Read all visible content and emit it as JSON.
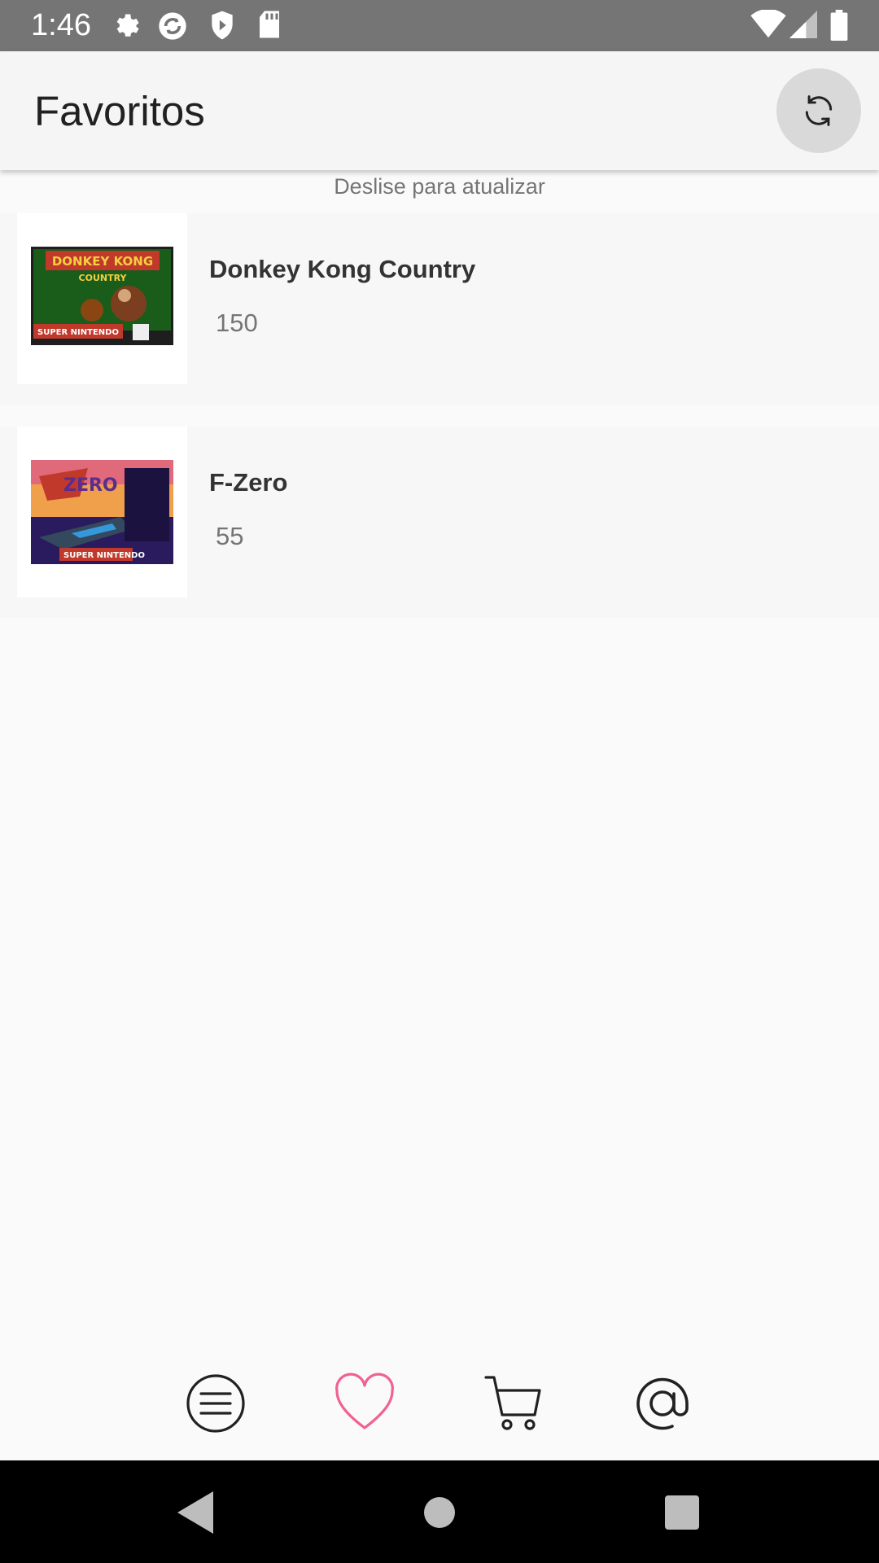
{
  "status_bar": {
    "time": "1:46",
    "icons_left": [
      "gear-icon",
      "sync-icon",
      "shield-icon",
      "sd-card-icon"
    ],
    "icons_right": [
      "wifi-icon",
      "signal-icon",
      "battery-icon"
    ]
  },
  "app_bar": {
    "title": "Favoritos",
    "refresh_icon": "refresh-icon"
  },
  "list": {
    "pull_hint": "Deslise para atualizar",
    "items": [
      {
        "title": "Donkey Kong Country",
        "price": "150",
        "cover_text": "DONKEY KONG COUNTRY",
        "cover_footer": "SUPER NINTENDO",
        "cover_colors": [
          "#1a5c1a",
          "#c0392b",
          "#1e1e1e"
        ]
      },
      {
        "title": "F-Zero",
        "price": "55",
        "cover_text": "F-ZERO",
        "cover_footer": "SUPER NINTENDO",
        "cover_colors": [
          "#2a1b5e",
          "#e84a5f",
          "#1e1e1e"
        ]
      }
    ]
  },
  "bottom_nav": {
    "items": [
      {
        "icon": "menu-icon",
        "active": false
      },
      {
        "icon": "heart-icon",
        "active": true
      },
      {
        "icon": "cart-icon",
        "active": false
      },
      {
        "icon": "at-sign-icon",
        "active": false
      }
    ],
    "active_color": "#f06292",
    "inactive_color": "#212121"
  },
  "system_nav": {
    "items": [
      "back-icon",
      "home-icon",
      "recents-icon"
    ]
  }
}
